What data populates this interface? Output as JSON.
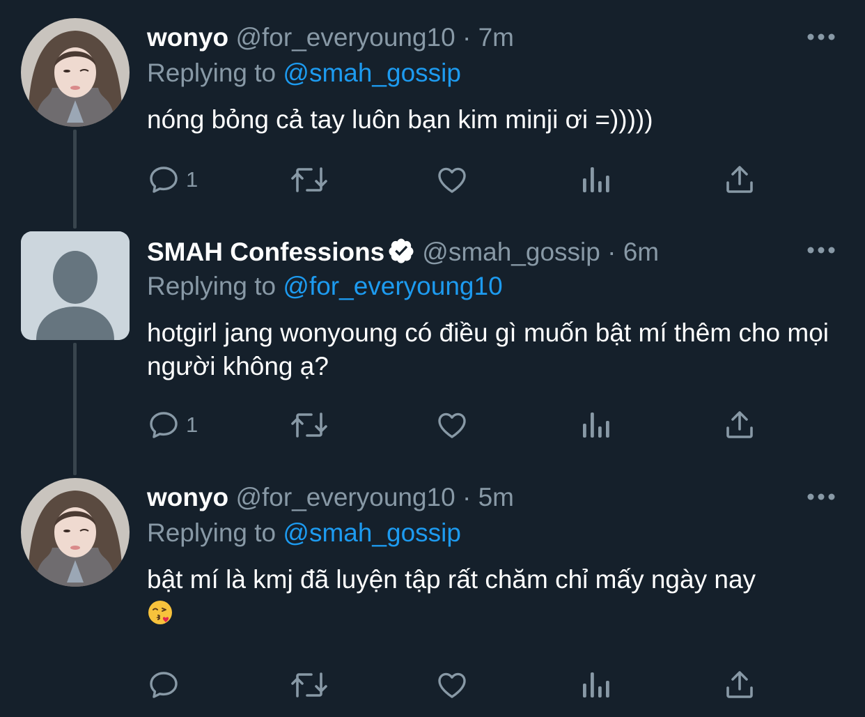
{
  "thread": [
    {
      "display_name": "wonyo",
      "handle": "@for_everyoung10",
      "separator": "·",
      "time": "7m",
      "replying_prefix": "Replying to",
      "replying_to": "@smah_gossip",
      "text": "nóng bỏng cả tay luôn bạn kim minji ơi =)))))",
      "reply_count": "1",
      "verified": false,
      "avatar_icon": "profile-photo"
    },
    {
      "display_name": "SMAH Confessions",
      "handle": "@smah_gossip",
      "separator": "·",
      "time": "6m",
      "replying_prefix": "Replying to",
      "replying_to": "@for_everyoung10",
      "text": "hotgirl jang wonyoung có điều gì muốn bật mí thêm cho mọi người không ạ?",
      "reply_count": "1",
      "verified": true,
      "avatar_icon": "default-avatar-icon"
    },
    {
      "display_name": "wonyo",
      "handle": "@for_everyoung10",
      "separator": "·",
      "time": "5m",
      "replying_prefix": "Replying to",
      "replying_to": "@smah_gossip",
      "text": "bật mí là kmj đã luyện tập rất chăm chỉ mấy ngày nay",
      "text_emoji": "face-blowing-kiss-emoji",
      "reply_count": "",
      "verified": false,
      "avatar_icon": "profile-photo"
    }
  ],
  "colors": {
    "background": "#15202b",
    "text_primary": "#ffffff",
    "text_secondary": "#8899a6",
    "accent": "#1d9bf0",
    "thread_line": "#38444d"
  },
  "action_icons": [
    "reply-icon",
    "retweet-icon",
    "like-icon",
    "analytics-icon",
    "share-icon"
  ],
  "more_icon": "more-options-icon"
}
